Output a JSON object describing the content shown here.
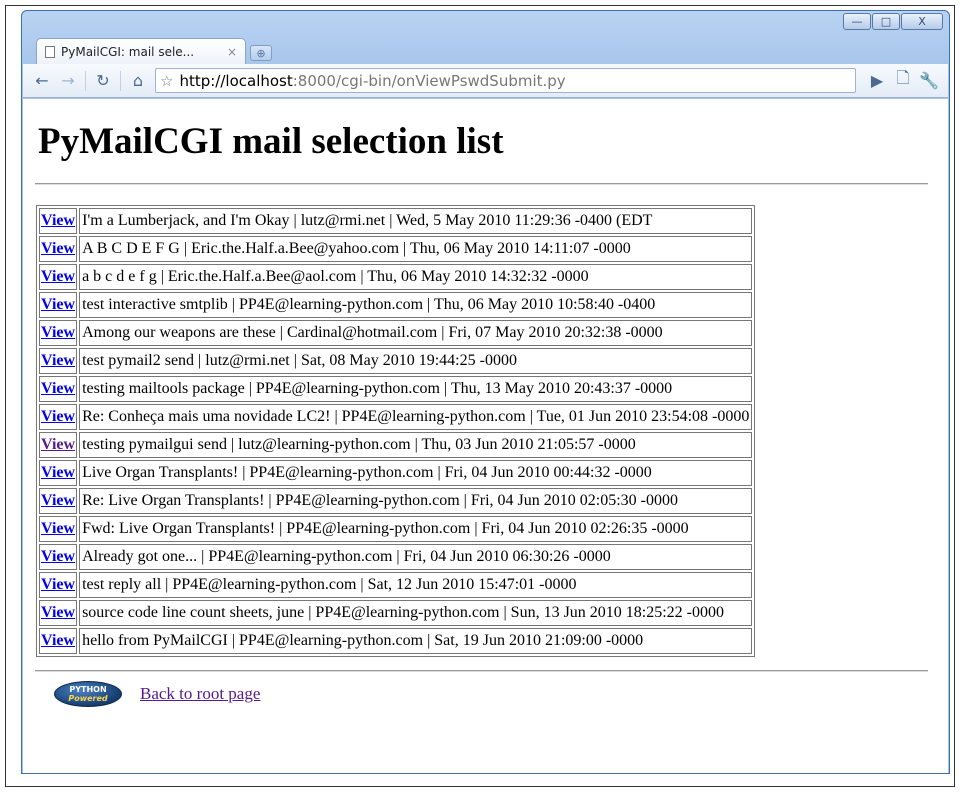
{
  "browser": {
    "tab_title": "PyMailCGI: mail sele...",
    "tab_close": "×",
    "new_tab": "⊕",
    "url_scheme_host": "http://localhost",
    "url_rest": ":8000/cgi-bin/onViewPswdSubmit.py",
    "window_controls": {
      "minimize": "—",
      "maximize": "□",
      "close": "X"
    }
  },
  "page": {
    "title": "PyMailCGI mail selection list",
    "view_label": "View",
    "logo_text_top": "PYTHON",
    "logo_text_bottom": "Powered",
    "back_link": "Back to root page"
  },
  "messages": [
    "I'm a Lumberjack, and I'm Okay | lutz@rmi.net | Wed, 5 May 2010 11:29:36 -0400 (EDT",
    "A B C D E F G | Eric.the.Half.a.Bee@yahoo.com | Thu, 06 May 2010 14:11:07 -0000",
    "a b c d e f g | Eric.the.Half.a.Bee@aol.com | Thu, 06 May 2010 14:32:32 -0000",
    "test interactive smtplib | PP4E@learning-python.com | Thu, 06 May 2010 10:58:40 -0400",
    "Among our weapons are these | Cardinal@hotmail.com | Fri, 07 May 2010 20:32:38 -0000",
    "test pymail2 send | lutz@rmi.net | Sat, 08 May 2010 19:44:25 -0000",
    "testing mailtools package | PP4E@learning-python.com | Thu, 13 May 2010 20:43:37 -0000",
    "Re: Conheça mais uma novidade LC2! | PP4E@learning-python.com | Tue, 01 Jun 2010 23:54:08 -0000",
    "testing pymailgui send | lutz@learning-python.com | Thu, 03 Jun 2010 21:05:57 -0000",
    "Live Organ Transplants! | PP4E@learning-python.com | Fri, 04 Jun 2010 00:44:32 -0000",
    "Re: Live Organ Transplants! | PP4E@learning-python.com | Fri, 04 Jun 2010 02:05:30 -0000",
    "Fwd: Live Organ Transplants! | PP4E@learning-python.com | Fri, 04 Jun 2010 02:26:35 -0000",
    "Already got one... | PP4E@learning-python.com | Fri, 04 Jun 2010 06:30:26 -0000",
    "test reply all | PP4E@learning-python.com | Sat, 12 Jun 2010 15:47:01 -0000",
    "source code line count sheets, june | PP4E@learning-python.com | Sun, 13 Jun 2010 18:25:22 -0000",
    "hello from PyMailCGI | PP4E@learning-python.com | Sat, 19 Jun 2010 21:09:00 -0000"
  ],
  "visited_rows": [
    8
  ]
}
